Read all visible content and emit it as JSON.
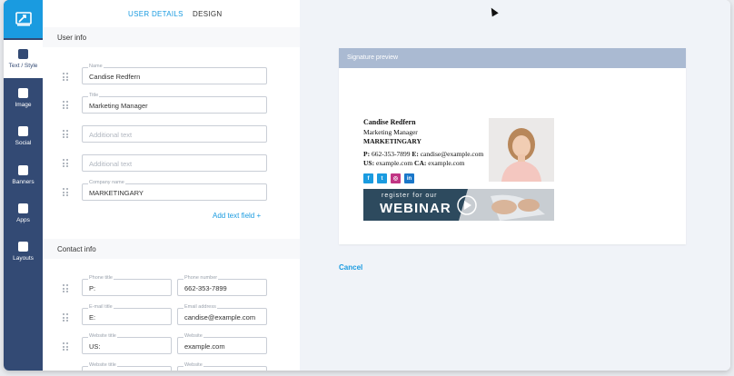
{
  "tabs": {
    "user_details": "USER DETAILS",
    "design": "DESIGN"
  },
  "sidebar": {
    "items": [
      {
        "label": "Text / Style",
        "icon": "text-style-icon"
      },
      {
        "label": "Image",
        "icon": "image-icon"
      },
      {
        "label": "Social",
        "icon": "share-icon"
      },
      {
        "label": "Banners",
        "icon": "banner-icon"
      },
      {
        "label": "Apps",
        "icon": "apps-icon"
      },
      {
        "label": "Layouts",
        "icon": "layouts-icon"
      }
    ]
  },
  "user_info": {
    "title": "User info",
    "fields": [
      {
        "label": "Name",
        "value": "Candise Redfern",
        "placeholder": ""
      },
      {
        "label": "Title",
        "value": "Marketing Manager",
        "placeholder": ""
      },
      {
        "label": "",
        "value": "",
        "placeholder": "Additional text"
      },
      {
        "label": "",
        "value": "",
        "placeholder": "Additional text"
      },
      {
        "label": "Company name",
        "value": "MARKETINGARY",
        "placeholder": ""
      }
    ],
    "add_field": "Add text field  +"
  },
  "contact_info": {
    "title": "Contact info",
    "rows": [
      {
        "left_label": "Phone title",
        "left_value": "P:",
        "right_label": "Phone number",
        "right_value": "662-353-7899"
      },
      {
        "left_label": "E-mail title",
        "left_value": "E:",
        "right_label": "Email address",
        "right_value": "candise@example.com"
      },
      {
        "left_label": "Website title",
        "left_value": "US:",
        "right_label": "Website",
        "right_value": "example.com"
      },
      {
        "left_label": "Website title",
        "left_value": "",
        "right_label": "Website",
        "right_value": ""
      }
    ]
  },
  "preview": {
    "header": "Signature preview",
    "name": "Candise Redfern",
    "title": "Marketing Manager",
    "company": "MARKETINGARY",
    "phone_label": "P:",
    "phone": "662-353-7899",
    "email_label": "E:",
    "email": "candise@example.com",
    "us_label": "US:",
    "us_site": "example.com",
    "ca_label": "CA:",
    "ca_site": "example.com",
    "social": [
      {
        "icon": "facebook-icon",
        "glyph": "f",
        "color": "#1a9be0"
      },
      {
        "icon": "twitter-icon",
        "glyph": "t",
        "color": "#1a9be0"
      },
      {
        "icon": "instagram-icon",
        "glyph": "◎",
        "color": "#c13584"
      },
      {
        "icon": "linkedin-icon",
        "glyph": "in",
        "color": "#1a77c9"
      }
    ],
    "banner_line1": "register for our",
    "banner_line2": "WEBINAR"
  },
  "cancel_label": "Cancel",
  "colors": {
    "accent": "#1a9be0",
    "sidebar": "#334a74",
    "preview_header": "#aabad2"
  }
}
